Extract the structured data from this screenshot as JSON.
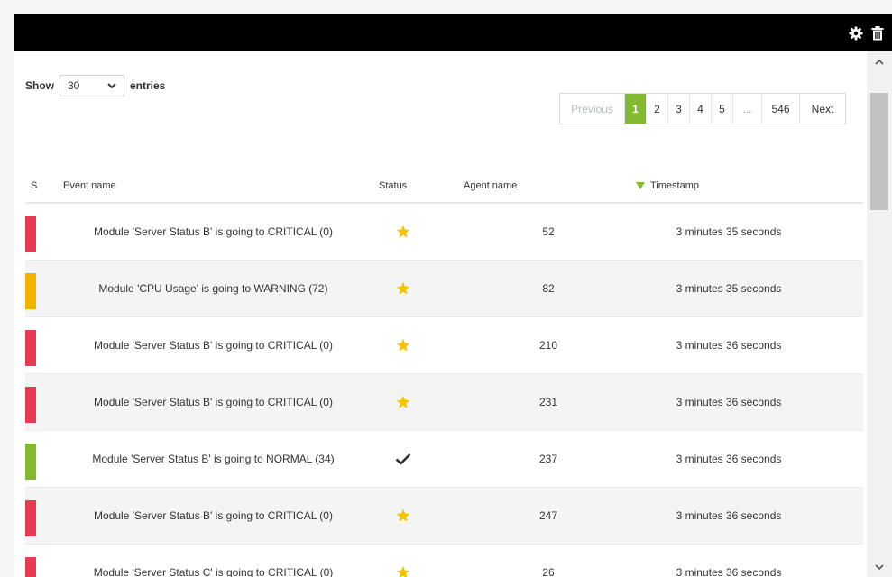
{
  "titlebar": {
    "settings_icon": "gear-icon",
    "delete_icon": "trash-icon"
  },
  "length": {
    "show_label": "Show",
    "value": "30",
    "entries_label": "entries"
  },
  "pagination": {
    "previous": "Previous",
    "pages": [
      "1",
      "2",
      "3",
      "4",
      "5"
    ],
    "active_page": "1",
    "ellipsis": "...",
    "last_page": "546",
    "next": "Next"
  },
  "table": {
    "columns": {
      "severity": "S",
      "event_name": "Event name",
      "status": "Status",
      "agent": "Agent name",
      "timestamp": "Timestamp"
    },
    "sort_indicator_color": "#82b92e",
    "rows": [
      {
        "severity_color": "#e63c52",
        "event": "Module 'Server Status B' is going to CRITICAL (0)",
        "status_icon": "star-icon",
        "agent": "52",
        "time": "3 minutes 35 seconds"
      },
      {
        "severity_color": "#f3b200",
        "event": "Module 'CPU Usage' is going to WARNING (72)",
        "status_icon": "star-icon",
        "agent": "82",
        "time": "3 minutes 35 seconds"
      },
      {
        "severity_color": "#e63c52",
        "event": "Module 'Server Status B' is going to CRITICAL (0)",
        "status_icon": "star-icon",
        "agent": "210",
        "time": "3 minutes 36 seconds"
      },
      {
        "severity_color": "#e63c52",
        "event": "Module 'Server Status B' is going to CRITICAL (0)",
        "status_icon": "star-icon",
        "agent": "231",
        "time": "3 minutes 36 seconds"
      },
      {
        "severity_color": "#82b92e",
        "event": "Module 'Server Status B' is going to NORMAL (34)",
        "status_icon": "check-icon",
        "agent": "237",
        "time": "3 minutes 36 seconds"
      },
      {
        "severity_color": "#e63c52",
        "event": "Module 'Server Status B' is going to CRITICAL (0)",
        "status_icon": "star-icon",
        "agent": "247",
        "time": "3 minutes 36 seconds"
      },
      {
        "severity_color": "#e63c52",
        "event": "Module 'Server Status C' is going to CRITICAL (0)",
        "status_icon": "star-icon",
        "agent": "26",
        "time": "3 minutes 36 seconds"
      }
    ]
  }
}
